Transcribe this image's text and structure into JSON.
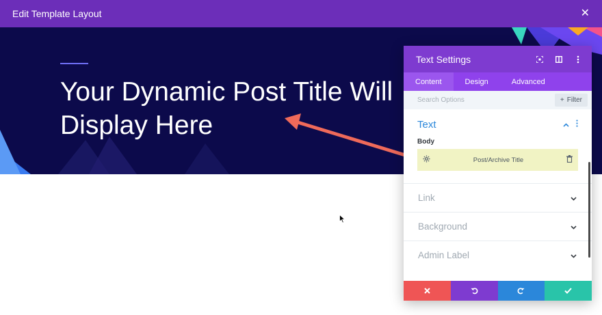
{
  "modal": {
    "title": "Edit Template Layout",
    "close_icon": "close-icon"
  },
  "hero": {
    "title": "Your Dynamic Post Title Will Display Here"
  },
  "panel": {
    "title": "Text Settings",
    "header_icons": [
      "expand-icon",
      "split-view-icon",
      "more-vertical-icon"
    ],
    "tabs": [
      {
        "label": "Content",
        "active": true
      },
      {
        "label": "Design",
        "active": false
      },
      {
        "label": "Advanced",
        "active": false
      }
    ],
    "search_placeholder": "Search Options",
    "filter_label": "Filter",
    "text_section": {
      "title": "Text",
      "body_label": "Body",
      "dynamic_value": "Post/Archive Title"
    },
    "collapsed_sections": [
      "Link",
      "Background",
      "Admin Label"
    ]
  },
  "footer_buttons": [
    "cancel-icon",
    "undo-icon",
    "redo-icon",
    "save-check-icon"
  ],
  "colors": {
    "header_purple": "#6c2eb9",
    "panel_purple": "#7e3bd0",
    "hero_navy": "#0c0a4b",
    "accent_blue": "#2b87da",
    "cancel_red": "#ef5555",
    "save_teal": "#29c4a9",
    "annotation_arrow": "#ef6a5a",
    "dynamic_highlight": "#f1f3c4"
  }
}
